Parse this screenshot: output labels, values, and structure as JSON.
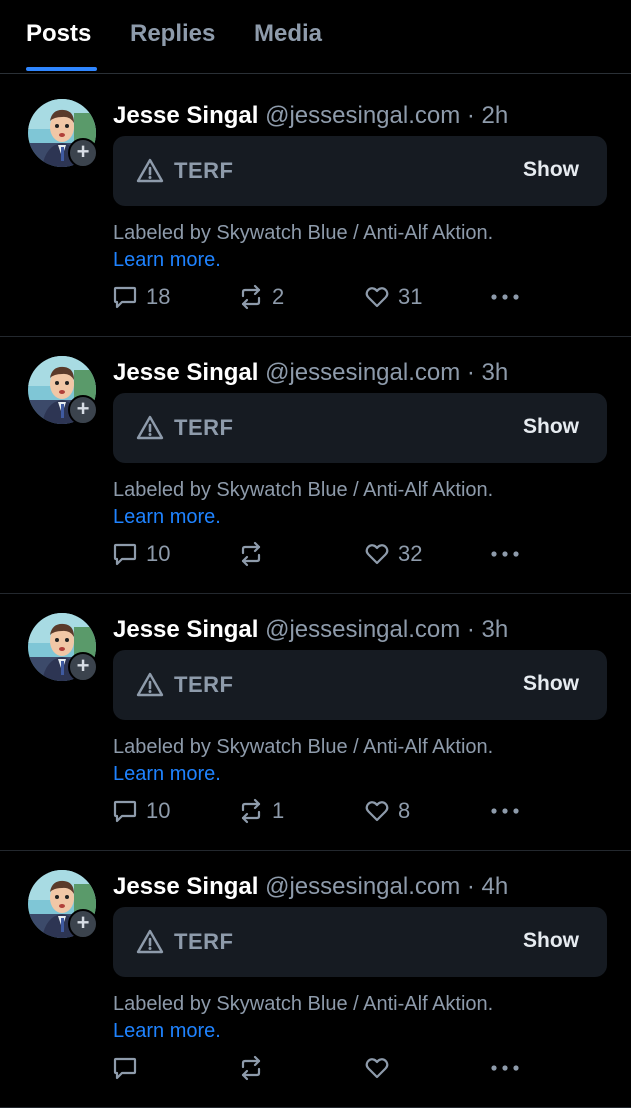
{
  "tabs": [
    {
      "label": "Posts",
      "active": true
    },
    {
      "label": "Replies",
      "active": false
    },
    {
      "label": "Media",
      "active": false
    }
  ],
  "posts": [
    {
      "author_name": "Jesse Singal",
      "handle": "@jessesingal.com",
      "separator": "·",
      "time": "2h",
      "label": "TERF",
      "show_label": "Show",
      "labeled_by": "Labeled by Skywatch Blue / Anti-Alf Aktion.",
      "learn_more": "Learn more.",
      "replies": "18",
      "reposts": "2",
      "likes": "31"
    },
    {
      "author_name": "Jesse Singal",
      "handle": "@jessesingal.com",
      "separator": "·",
      "time": "3h",
      "label": "TERF",
      "show_label": "Show",
      "labeled_by": "Labeled by Skywatch Blue / Anti-Alf Aktion.",
      "learn_more": "Learn more.",
      "replies": "10",
      "reposts": "",
      "likes": "32"
    },
    {
      "author_name": "Jesse Singal",
      "handle": "@jessesingal.com",
      "separator": "·",
      "time": "3h",
      "label": "TERF",
      "show_label": "Show",
      "labeled_by": "Labeled by Skywatch Blue / Anti-Alf Aktion.",
      "learn_more": "Learn more.",
      "replies": "10",
      "reposts": "1",
      "likes": "8"
    },
    {
      "author_name": "Jesse Singal",
      "handle": "@jessesingal.com",
      "separator": "·",
      "time": "4h",
      "label": "TERF",
      "show_label": "Show",
      "labeled_by": "Labeled by Skywatch Blue / Anti-Alf Aktion.",
      "learn_more": "Learn more.",
      "replies": "",
      "reposts": "",
      "likes": ""
    }
  ],
  "icons": {
    "warning": "warning-triangle-icon",
    "reply": "reply-bubble-icon",
    "repost": "repost-arrows-icon",
    "like": "heart-icon",
    "more": "more-dots-icon",
    "follow": "plus-icon"
  },
  "colors": {
    "background": "#000000",
    "accent": "#2f86ff",
    "link": "#1f83ff",
    "muted_text": "#8e9bab",
    "label_box": "#161b22"
  }
}
